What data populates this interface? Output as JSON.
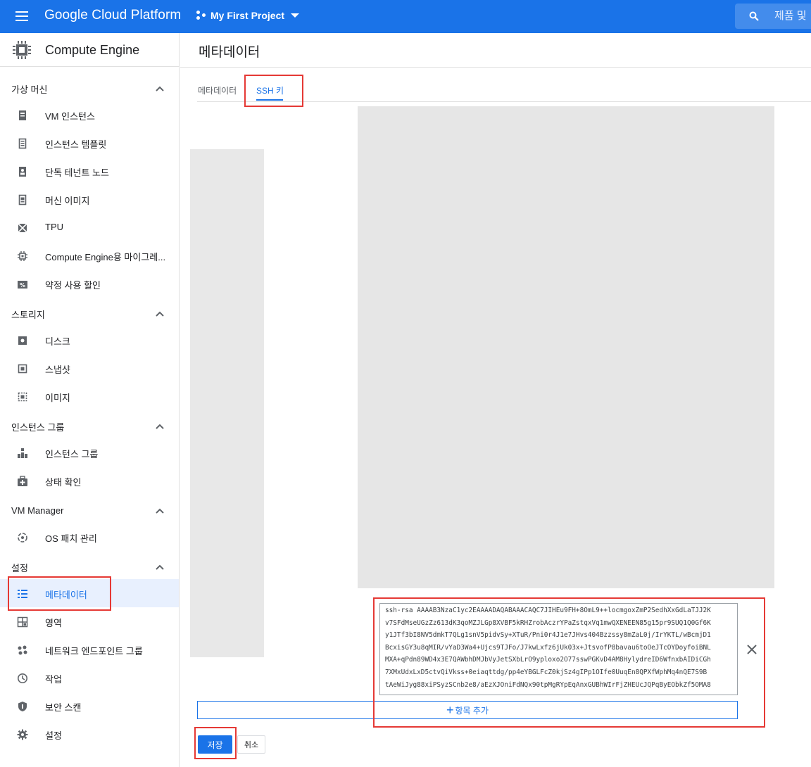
{
  "topbar": {
    "brand": "Google Cloud Platform",
    "project_name": "My First Project",
    "search_placeholder": "제품 및"
  },
  "sidebar": {
    "product_title": "Compute Engine",
    "sections": [
      {
        "title": "가상 머신",
        "items": [
          {
            "label": "VM 인스턴스",
            "icon": "vm-instance-icon"
          },
          {
            "label": "인스턴스 템플릿",
            "icon": "template-icon"
          },
          {
            "label": "단독 테넌트 노드",
            "icon": "sole-tenant-icon"
          },
          {
            "label": "머신 이미지",
            "icon": "machine-image-icon"
          },
          {
            "label": "TPU",
            "icon": "tpu-icon"
          },
          {
            "label": "Compute Engine용 마이그레...",
            "icon": "migrate-icon"
          },
          {
            "label": "약정 사용 할인",
            "icon": "discount-icon"
          }
        ]
      },
      {
        "title": "스토리지",
        "items": [
          {
            "label": "디스크",
            "icon": "disk-icon"
          },
          {
            "label": "스냅샷",
            "icon": "snapshot-icon"
          },
          {
            "label": "이미지",
            "icon": "image-icon"
          }
        ]
      },
      {
        "title": "인스턴스 그룹",
        "items": [
          {
            "label": "인스턴스 그룹",
            "icon": "instance-group-icon"
          },
          {
            "label": "상태 확인",
            "icon": "health-check-icon"
          }
        ]
      },
      {
        "title": "VM Manager",
        "items": [
          {
            "label": "OS 패치 관리",
            "icon": "os-patch-icon"
          }
        ]
      },
      {
        "title": "설정",
        "items": [
          {
            "label": "메타데이터",
            "icon": "metadata-icon"
          },
          {
            "label": "영역",
            "icon": "zones-icon"
          },
          {
            "label": "네트워크 엔드포인트 그룹",
            "icon": "network-endpoint-icon"
          },
          {
            "label": "작업",
            "icon": "operations-icon"
          },
          {
            "label": "보안 스캔",
            "icon": "security-scan-icon"
          },
          {
            "label": "설정",
            "icon": "settings-gear-icon"
          }
        ]
      }
    ],
    "active_item": "메타데이터"
  },
  "main": {
    "page_title": "메타데이터",
    "tabs": [
      {
        "label": "메타데이터"
      },
      {
        "label": "SSH 키"
      }
    ],
    "active_tab": "SSH 키",
    "ssh_key_value": "ssh-rsa AAAAB3NzaC1yc2EAAAADAQABAAACAQC7JIHEu9FH+8OmL9++locmgoxZmP2SedhXxGdLaTJJ2K\nv7SFdMseUGzZz613dK3qoMZJLGp8XVBF5kRHZrobAczrYPaZstqxVq1mwQXENEEN85g15pr9SUQ1Q0Gf6K\ny1JTf3bI8NV5dmkT7QLg1snV5pidvSy+XTuR/Pni0r4J1e7JHvs404Bzzssy8mZaL0j/IrYKTL/wBcmjD1\nBcxisGY3u8qMIR/vYaD3Wa4+Ujcs9TJFo/J7kwLxfz6jUk03x+JtsvofP8bavau6toOeJTcOYDoyfoiBNL\nMXA+qPdn89WD4x3E7QAWbhDMJbVyJetSXbLrO9yploxo2O77sswPGKvD4AM8HylydreID6WfnxbAIDiCGh\n7XMxUdxLxD5ctvQiVkss+0eiaqttdg/pp4eYBGLFcZ0kjSz4gIPp1OIfe0UuqEn8QPXfWphMq4nQE7S9B\ntAeWiJyg88xiPSyzSCnb2e8/aEzXJOniFdNQx90tpMgRYpEqAnxGUBhWIrFjZHEUcJQPqByEObkZf5OMA8",
    "add_item_label": "항목 추가",
    "save_label": "저장",
    "cancel_label": "취소"
  },
  "colors": {
    "brand_blue": "#1a73e8",
    "annotation_red": "#e53935"
  }
}
